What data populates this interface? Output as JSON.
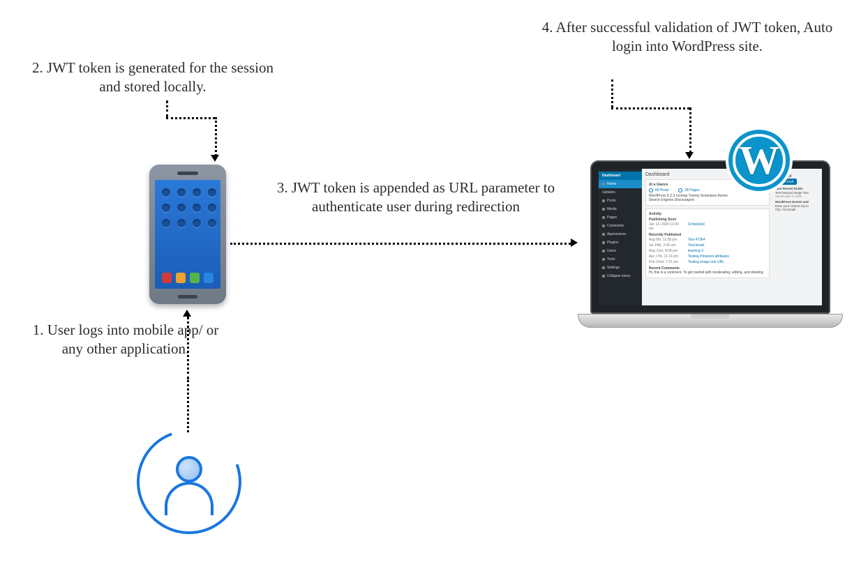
{
  "steps": {
    "s1": "1. User logs into mobile app/ or any other application.",
    "s2": "2. JWT token is generated for the session and stored locally.",
    "s3": "3. JWT token is appended as URL parameter to authenticate user during redirection",
    "s4": "4. After successful validation of JWT token, Auto login into WordPress site."
  },
  "wp": {
    "badge": "W",
    "top": "Dashboard",
    "menu": [
      "Home",
      "Updates",
      "Posts",
      "Media",
      "Pages",
      "Comments",
      "Appearance",
      "Plugins",
      "Users",
      "Tools",
      "Settings",
      "Collapse menu"
    ],
    "title": "Dashboard",
    "glance_title": "At a Glance",
    "glance_posts": "69 Posts",
    "glance_pages": "28 Pages",
    "glance_note": "WordPress 5.2.3 running Twenty Seventeen theme.\nSearch Engines Discouraged",
    "activity_title": "Activity",
    "pub_soon": "Publishing Soon",
    "pub_row": [
      "Jan 14, 2020  12:00 am",
      "Scheduled"
    ],
    "recent": "Recently Published",
    "rows": [
      [
        "Aug 6th, 11:58 pm",
        "Test 47364"
      ],
      [
        "Jul 14th, 3:40 am",
        "Test break"
      ],
      [
        "May 21st, 9:08 pm",
        "learning 3"
      ],
      [
        "Apr 17th, 11:14 pm",
        "Testing Pinterest attributes"
      ],
      [
        "Feb 22nd, 7:31 pm",
        "Testing image one URL"
      ]
    ],
    "recent_comments": "Recent Comments",
    "comment": "Hi, this is a comment. To get started with moderating, editing, and deleting",
    "quick_title": "Quick Draft",
    "quick_btn": "Save Draft",
    "drafts_hd": "Your Recent Drafts",
    "drafts_line": "Test featured image Test",
    "drafts_date": "Saved April 3, 2020",
    "events_hd": "WordPress Events and",
    "events_line": "Enter your closest city to",
    "events_city": "City: Cincinnati"
  }
}
